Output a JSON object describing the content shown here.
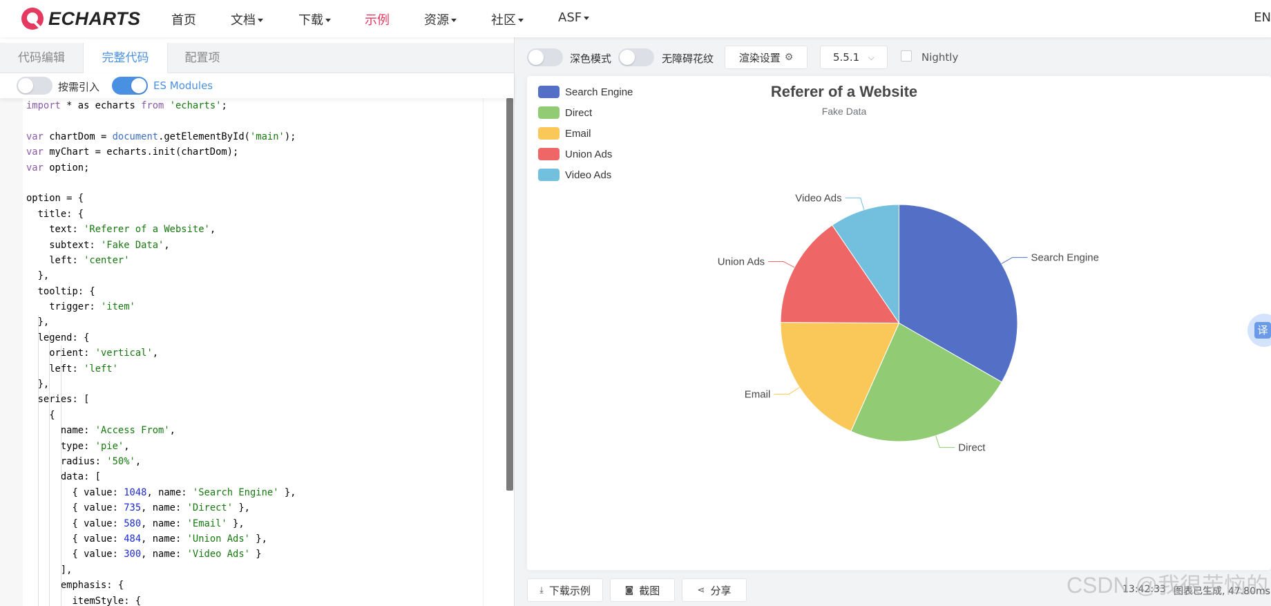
{
  "nav": {
    "logo_text": "ECHARTS",
    "items": [
      {
        "label": "首页",
        "dropdown": false,
        "active": false
      },
      {
        "label": "文档",
        "dropdown": true,
        "active": false
      },
      {
        "label": "下载",
        "dropdown": true,
        "active": false
      },
      {
        "label": "示例",
        "dropdown": false,
        "active": true
      },
      {
        "label": "资源",
        "dropdown": true,
        "active": false
      },
      {
        "label": "社区",
        "dropdown": true,
        "active": false
      },
      {
        "label": "ASF",
        "dropdown": true,
        "active": false
      }
    ],
    "lang": "EN",
    "active_color": "#e43961"
  },
  "editor": {
    "tabs": [
      "代码编辑",
      "完整代码",
      "配置项"
    ],
    "active_tab": "完整代码",
    "toggle_on_demand": {
      "label": "按需引入",
      "on": false
    },
    "toggle_esm": {
      "label": "ES Modules",
      "on": true
    },
    "code_lines": [
      "import * as echarts from 'echarts';",
      "",
      "var chartDom = document.getElementById('main');",
      "var myChart = echarts.init(chartDom);",
      "var option;",
      "",
      "option = {",
      "  title: {",
      "    text: 'Referer of a Website',",
      "    subtext: 'Fake Data',",
      "    left: 'center'",
      "  },",
      "  tooltip: {",
      "    trigger: 'item'",
      "  },",
      "  legend: {",
      "    orient: 'vertical',",
      "    left: 'left'",
      "  },",
      "  series: [",
      "    {",
      "      name: 'Access From',",
      "      type: 'pie',",
      "      radius: '50%',",
      "      data: [",
      "        { value: 1048, name: 'Search Engine' },",
      "        { value: 735, name: 'Direct' },",
      "        { value: 580, name: 'Email' },",
      "        { value: 484, name: 'Union Ads' },",
      "        { value: 300, name: 'Video Ads' }",
      "      ],",
      "      emphasis: {",
      "        itemStyle: {"
    ]
  },
  "preview": {
    "dark_mode_label": "深色模式",
    "accessibility_label": "无障碍花纹",
    "render_settings_label": "渲染设置",
    "version": "5.5.1",
    "nightly_label": "Nightly",
    "download_label": "下载示例",
    "screenshot_label": "截图",
    "share_label": "分享",
    "status_time": "13:42:33",
    "status_text": "图表已生成, 47.80ms",
    "translate_glyph": "译"
  },
  "watermark": "CSDN @我很苦恼的",
  "chart_data": {
    "type": "pie",
    "title": "Referer of a Website",
    "subtitle": "Fake Data",
    "legend_orient": "vertical",
    "legend_position": "top-left",
    "series_name": "Access From",
    "radius": "50%",
    "slices": [
      {
        "name": "Search Engine",
        "value": 1048,
        "color": "#5470c6"
      },
      {
        "name": "Direct",
        "value": 735,
        "color": "#91cc75"
      },
      {
        "name": "Email",
        "value": 580,
        "color": "#fac858"
      },
      {
        "name": "Union Ads",
        "value": 484,
        "color": "#ee6666"
      },
      {
        "name": "Video Ads",
        "value": 300,
        "color": "#73c0de"
      }
    ]
  }
}
